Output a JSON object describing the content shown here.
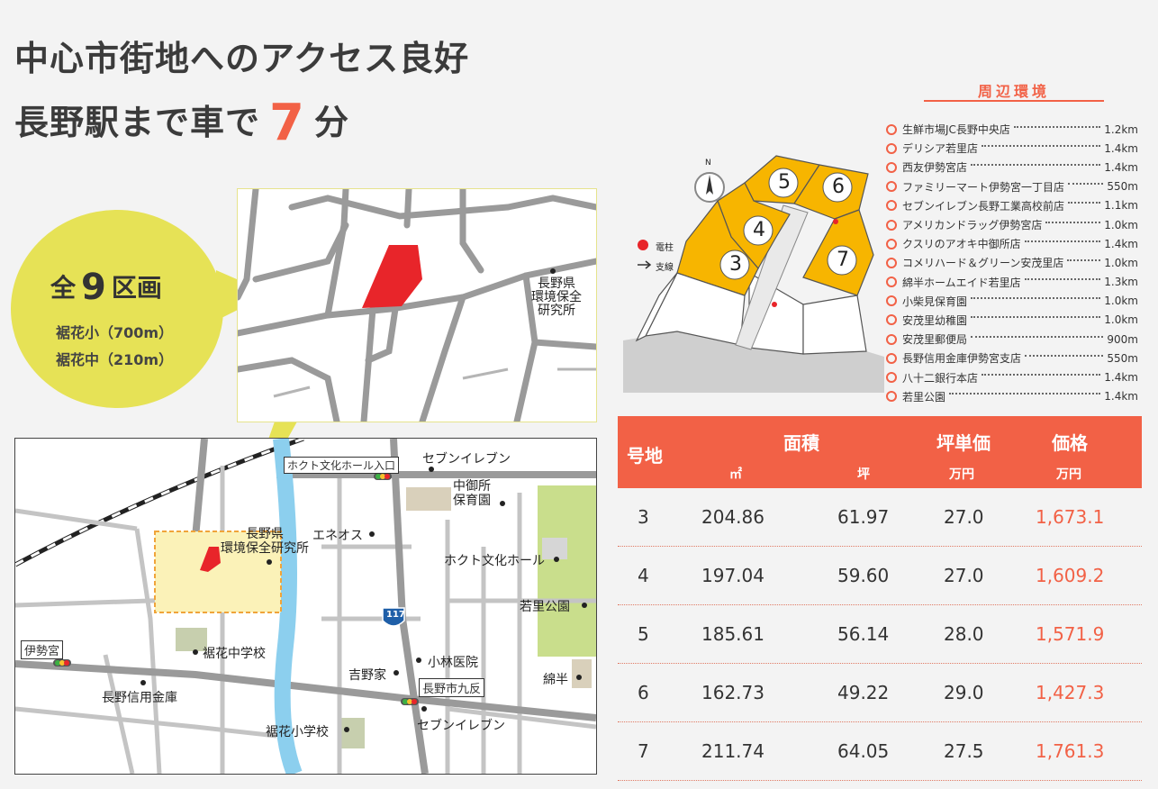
{
  "headline": {
    "line1": "中心市街地へのアクセス良好",
    "line2_prefix": "長野駅まで車で",
    "line2_number": "7",
    "line2_suffix": "分"
  },
  "bubble": {
    "lots_prefix": "全",
    "lots_number": "9",
    "lots_suffix": "区画",
    "schools": [
      "裾花小（700m）",
      "裾花中（210m）"
    ]
  },
  "zoom_map": {
    "labels": [
      "長野県",
      "環境保全",
      "研究所"
    ]
  },
  "area_map": {
    "labels": {
      "hokuto_entrance": "ホクト文化ホール入口",
      "seven_top": "セブンイレブン",
      "nursery": [
        "中御所",
        "保育園"
      ],
      "eneos": "エネオス",
      "institute": [
        "長野県",
        "環境保全研究所"
      ],
      "hokuto_hall": "ホクト文化ホール",
      "wakasato_park": "若里公園",
      "route": "117",
      "isemiya": "伊勢宮",
      "susobana_jhs": "裾花中学校",
      "kobayashi": "小林医院",
      "yoshinoya": "吉野家",
      "watahan": "綿半",
      "shinkin": "長野信用金庫",
      "kutanda": "長野市九反",
      "susobana_es": "裾花小学校",
      "seven_bottom": "セブンイレブン"
    }
  },
  "lot_map": {
    "north": "N",
    "legend_pole": "電柱",
    "legend_branch": "支線",
    "lots": [
      "3",
      "4",
      "5",
      "6",
      "7"
    ]
  },
  "environment": {
    "title": "周辺環境",
    "items": [
      {
        "name": "生鮮市場JC長野中央店",
        "dist": "1.2km"
      },
      {
        "name": "デリシア若里店",
        "dist": "1.4km"
      },
      {
        "name": "西友伊勢宮店",
        "dist": "1.4km"
      },
      {
        "name": "ファミリーマート伊勢宮一丁目店",
        "dist": "550m"
      },
      {
        "name": "セブンイレブン長野工業高校前店",
        "dist": "1.1km"
      },
      {
        "name": "アメリカンドラッグ伊勢宮店",
        "dist": "1.0km"
      },
      {
        "name": "クスリのアオキ中御所店",
        "dist": "1.4km"
      },
      {
        "name": "コメリハード＆グリーン安茂里店",
        "dist": "1.0km"
      },
      {
        "name": "綿半ホームエイド若里店",
        "dist": "1.3km"
      },
      {
        "name": "小柴見保育園",
        "dist": "1.0km"
      },
      {
        "name": "安茂里幼稚園",
        "dist": "1.0km"
      },
      {
        "name": "安茂里郵便局",
        "dist": "900m"
      },
      {
        "name": "長野信用金庫伊勢宮支店",
        "dist": "550m"
      },
      {
        "name": "八十二銀行本店",
        "dist": "1.4km"
      },
      {
        "name": "若里公園",
        "dist": "1.4km"
      }
    ]
  },
  "price_table": {
    "headers": {
      "lot": "号地",
      "area": "面積",
      "area_m2": "㎡",
      "area_tsubo": "坪",
      "unit_price": "坪単価",
      "unit_price_unit": "万円",
      "price": "価格",
      "price_unit": "万円"
    },
    "rows": [
      {
        "lot": "3",
        "m2": "204.86",
        "tsubo": "61.97",
        "unit": "27.0",
        "price": "1,673.1"
      },
      {
        "lot": "4",
        "m2": "197.04",
        "tsubo": "59.60",
        "unit": "27.0",
        "price": "1,609.2"
      },
      {
        "lot": "5",
        "m2": "185.61",
        "tsubo": "56.14",
        "unit": "28.0",
        "price": "1,571.9"
      },
      {
        "lot": "6",
        "m2": "162.73",
        "tsubo": "49.22",
        "unit": "29.0",
        "price": "1,427.3"
      },
      {
        "lot": "7",
        "m2": "211.74",
        "tsubo": "64.05",
        "unit": "27.5",
        "price": "1,761.3"
      }
    ]
  },
  "colors": {
    "accent": "#f26146",
    "lot_fill": "#f7b500",
    "bubble": "#e6e256",
    "highlight": "#e8252a",
    "river": "#8ccfee",
    "park": "#c9de8c"
  }
}
